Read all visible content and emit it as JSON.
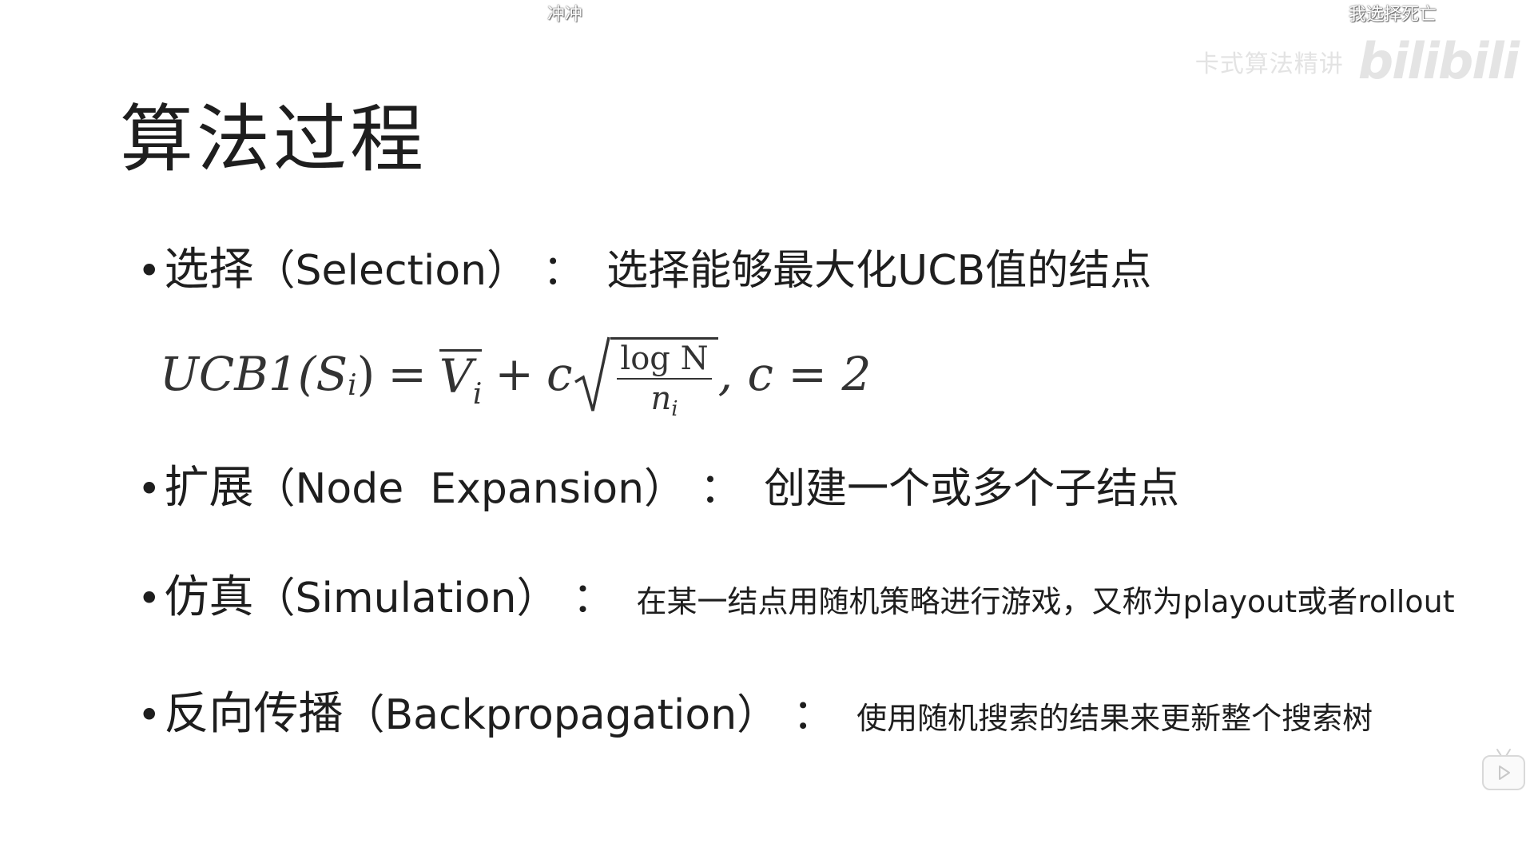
{
  "danmaku": [
    {
      "text": "冲冲"
    },
    {
      "text": "我选择死亡"
    }
  ],
  "watermark": {
    "text": "卡式算法精讲",
    "logo": "bilibili"
  },
  "slide": {
    "title": "算法过程",
    "bullets": [
      {
        "term": "选择",
        "english": "（Selection）",
        "colon": "：",
        "description": "选择能够最大化UCB值的结点"
      },
      {
        "term": "扩展",
        "english": "（Node  Expansion）",
        "colon": "：",
        "description": "创建一个或多个子结点"
      },
      {
        "term": "仿真",
        "english": "（Simulation）",
        "colon": "：",
        "description": "在某一结点用随机策略进行游戏，又称为playout或者rollout"
      },
      {
        "term": "反向传播",
        "english": "（Backpropagation）",
        "colon": "：",
        "description": "使用随机搜索的结果来更新整个搜索树"
      }
    ],
    "formula": {
      "lhs": "UCB1(S",
      "lhs_sub": "i",
      "lhs_close": ")",
      "equals": "=",
      "v": "V",
      "v_sub": "i",
      "plus": "+",
      "c": "c",
      "frac_num": "log N",
      "frac_den": "n",
      "frac_den_sub": "i",
      "tail": ", c = 2"
    }
  },
  "player": {
    "play_icon": "play-icon"
  }
}
